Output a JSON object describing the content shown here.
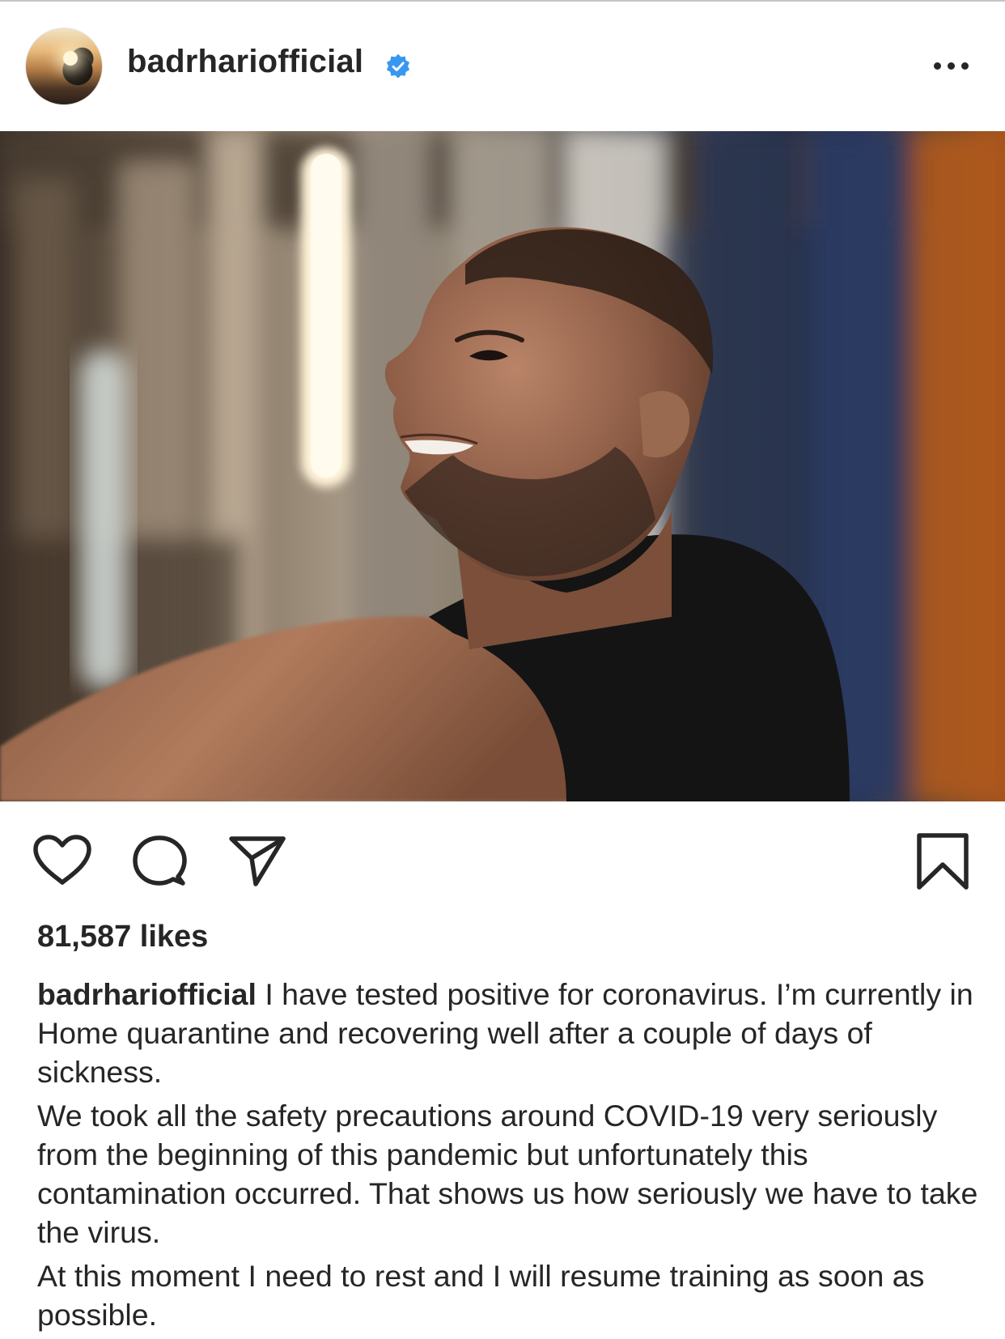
{
  "post": {
    "username": "badrhariofficial",
    "verified": true,
    "likes_text": "81,587 likes",
    "caption_paragraphs": [
      "I have tested positive for coronavirus. I’m currently in Home quarantine and recovering well after a couple of days of sickness.",
      "We took all the safety precautions around COVID-19 very seriously from the beginning of this pandemic but unfortunately this contamination occurred. That shows us how seriously we have to take the virus.",
      "At this moment I need to rest and I will resume training as soon as possible."
    ]
  },
  "icons": {
    "verified": "verified-badge-icon",
    "more": "more-options-icon",
    "like": "heart-icon",
    "comment": "comment-bubble-icon",
    "share": "paper-plane-icon",
    "save": "bookmark-icon"
  },
  "colors": {
    "text": "#262626",
    "verified_blue": "#3897f0",
    "divider": "#c7c7c7"
  }
}
